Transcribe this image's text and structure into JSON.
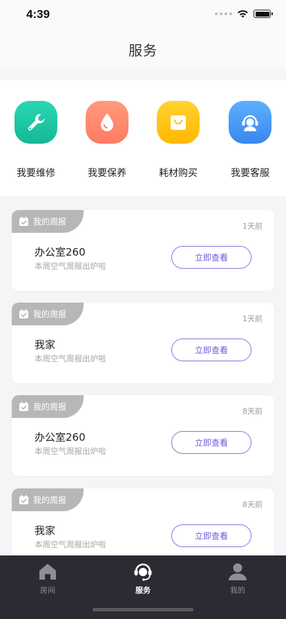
{
  "status_bar": {
    "time": "4:39"
  },
  "header": {
    "title": "服务"
  },
  "services": [
    {
      "label": "我要维修",
      "icon": "wrench-icon",
      "color": "#1fc9a6"
    },
    {
      "label": "我要保养",
      "icon": "water-drop-icon",
      "color": "#ff8a6e"
    },
    {
      "label": "耗材购买",
      "icon": "shopping-bag-icon",
      "color": "#ffc61c"
    },
    {
      "label": "我要客服",
      "icon": "customer-service-icon",
      "color": "#4a9cf5"
    }
  ],
  "reports": [
    {
      "tag": "我的周报",
      "time": "1天前",
      "title": "办公室260",
      "subtitle": "本周空气周报出炉啦",
      "button": "立即查看"
    },
    {
      "tag": "我的周报",
      "time": "1天前",
      "title": "我家",
      "subtitle": "本周空气周报出炉啦",
      "button": "立即查看"
    },
    {
      "tag": "我的周报",
      "time": "8天前",
      "title": "办公室260",
      "subtitle": "本周空气周报出炉啦",
      "button": "立即查看"
    },
    {
      "tag": "我的周报",
      "time": "8天前",
      "title": "我家",
      "subtitle": "本周空气周报出炉啦",
      "button": "立即查看"
    }
  ],
  "tab_bar": {
    "items": [
      {
        "label": "房间",
        "icon": "house-icon",
        "active": false
      },
      {
        "label": "服务",
        "icon": "headset-icon",
        "active": true
      },
      {
        "label": "我的",
        "icon": "person-icon",
        "active": false
      }
    ]
  },
  "colors": {
    "accent": "#6e5bd8",
    "tab_bar_bg": "#2b2c33",
    "tag_bg": "#b7b7b7"
  }
}
